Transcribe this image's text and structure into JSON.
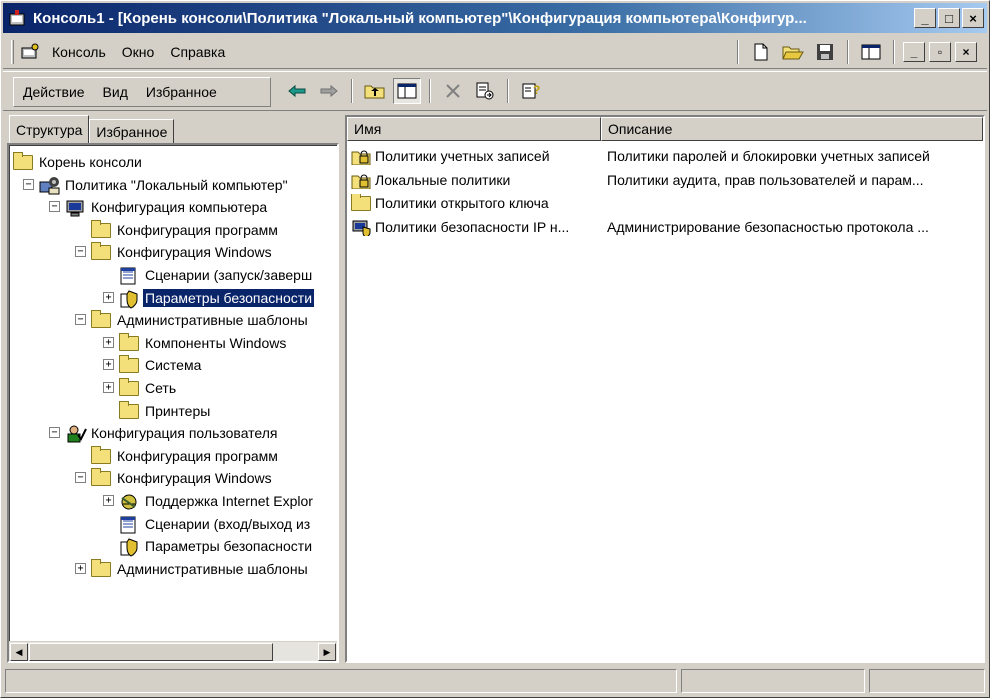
{
  "window": {
    "title": "Консоль1 - [Корень консоли\\Политика \"Локальный компьютер\"\\Конфигурация компьютера\\Конфигур...",
    "caption_buttons": [
      "_",
      "□",
      "×"
    ],
    "mdi_buttons": [
      "_",
      "▫",
      "×"
    ]
  },
  "menubar": {
    "items": [
      {
        "label": "Консоль"
      },
      {
        "label": "Окно"
      },
      {
        "label": "Справка"
      }
    ],
    "tools": [
      "new-icon",
      "open-folder-icon",
      "save-icon",
      "console-tree-icon"
    ]
  },
  "actionbar": {
    "items": [
      {
        "label": "Действие"
      },
      {
        "label": "Вид"
      },
      {
        "label": "Избранное"
      }
    ],
    "tools": [
      "back-arrow-icon",
      "forward-arrow-icon",
      "up-folder-icon",
      "show-hide-tree-icon",
      "delete-icon",
      "export-list-icon",
      "help-icon"
    ]
  },
  "left": {
    "tabs": [
      {
        "label": "Структура",
        "active": true
      },
      {
        "label": "Избранное",
        "active": false
      }
    ],
    "tree": [
      {
        "label": "Корень консоли",
        "depth": 0,
        "expander": "",
        "icon": "folder"
      },
      {
        "label": "Политика \"Локальный компьютер\"",
        "depth": 1,
        "expander": "−",
        "icon": "policy"
      },
      {
        "label": "Конфигурация компьютера",
        "depth": 2,
        "expander": "−",
        "icon": "computer"
      },
      {
        "label": "Конфигурация программ",
        "depth": 3,
        "expander": "",
        "icon": "folder"
      },
      {
        "label": "Конфигурация Windows",
        "depth": 3,
        "expander": "−",
        "icon": "folder"
      },
      {
        "label": "Сценарии (запуск/заверш",
        "depth": 4,
        "expander": "",
        "icon": "script"
      },
      {
        "label": "Параметры безопасности",
        "depth": 4,
        "expander": "+",
        "icon": "security",
        "selected": true
      },
      {
        "label": "Административные шаблоны",
        "depth": 3,
        "expander": "−",
        "icon": "folder"
      },
      {
        "label": "Компоненты Windows",
        "depth": 4,
        "expander": "+",
        "icon": "folder"
      },
      {
        "label": "Система",
        "depth": 4,
        "expander": "+",
        "icon": "folder"
      },
      {
        "label": "Сеть",
        "depth": 4,
        "expander": "+",
        "icon": "folder"
      },
      {
        "label": "Принтеры",
        "depth": 4,
        "expander": "",
        "icon": "folder"
      },
      {
        "label": "Конфигурация пользователя",
        "depth": 2,
        "expander": "−",
        "icon": "user"
      },
      {
        "label": "Конфигурация программ",
        "depth": 3,
        "expander": "",
        "icon": "folder"
      },
      {
        "label": "Конфигурация Windows",
        "depth": 3,
        "expander": "−",
        "icon": "folder"
      },
      {
        "label": "Поддержка Internet Explor",
        "depth": 4,
        "expander": "+",
        "icon": "ie"
      },
      {
        "label": "Сценарии (вход/выход из",
        "depth": 4,
        "expander": "",
        "icon": "script"
      },
      {
        "label": "Параметры безопасности",
        "depth": 4,
        "expander": "",
        "icon": "security"
      },
      {
        "label": "Административные шаблоны",
        "depth": 3,
        "expander": "+",
        "icon": "folder"
      }
    ]
  },
  "right": {
    "columns": [
      "Имя",
      "Описание"
    ],
    "rows": [
      {
        "name": "Политики учетных записей",
        "desc": "Политики паролей и блокировки учетных записей",
        "icon": "lock-folder"
      },
      {
        "name": "Локальные политики",
        "desc": "Политики аудита, прав пользователей и парам...",
        "icon": "lock-folder"
      },
      {
        "name": "Политики открытого ключа",
        "desc": "",
        "icon": "folder"
      },
      {
        "name": "Политики безопасности IP н...",
        "desc": "Администрирование безопасностью протокола ...",
        "icon": "ip-security"
      }
    ]
  },
  "colors": {
    "title_start": "#0a246a",
    "title_end": "#a6caf0",
    "selection": "#0a246a",
    "face": "#d4d0c8"
  }
}
